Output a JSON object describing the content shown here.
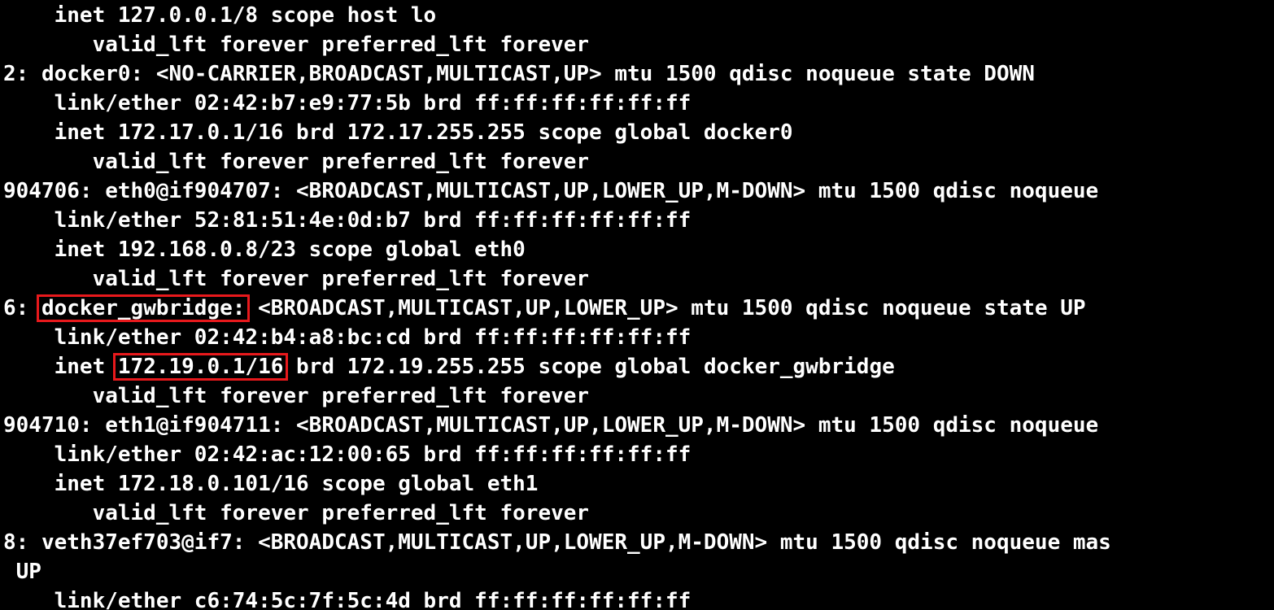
{
  "terminal": {
    "lines": [
      {
        "text": "    inet 127.0.0.1/8 scope host lo"
      },
      {
        "text": "       valid_lft forever preferred_lft forever"
      },
      {
        "text": "2: docker0: <NO-CARRIER,BROADCAST,MULTICAST,UP> mtu 1500 qdisc noqueue state DOWN"
      },
      {
        "text": "    link/ether 02:42:b7:e9:77:5b brd ff:ff:ff:ff:ff:ff"
      },
      {
        "text": "    inet 172.17.0.1/16 brd 172.17.255.255 scope global docker0"
      },
      {
        "text": "       valid_lft forever preferred_lft forever"
      },
      {
        "text": "904706: eth0@if904707: <BROADCAST,MULTICAST,UP,LOWER_UP,M-DOWN> mtu 1500 qdisc noqueue"
      },
      {
        "text": "    link/ether 52:81:51:4e:0d:b7 brd ff:ff:ff:ff:ff:ff"
      },
      {
        "text": "    inet 192.168.0.8/23 scope global eth0"
      },
      {
        "text": "       valid_lft forever preferred_lft forever"
      },
      {
        "prefix": "6: ",
        "highlight": "docker_gwbridge:",
        "suffix": " <BROADCAST,MULTICAST,UP,LOWER_UP> mtu 1500 qdisc noqueue state UP"
      },
      {
        "text": "    link/ether 02:42:b4:a8:bc:cd brd ff:ff:ff:ff:ff:ff"
      },
      {
        "prefix": "    inet ",
        "highlight": "172.19.0.1/16",
        "suffix": " brd 172.19.255.255 scope global docker_gwbridge"
      },
      {
        "text": "       valid_lft forever preferred_lft forever"
      },
      {
        "text": "904710: eth1@if904711: <BROADCAST,MULTICAST,UP,LOWER_UP,M-DOWN> mtu 1500 qdisc noqueue"
      },
      {
        "text": "    link/ether 02:42:ac:12:00:65 brd ff:ff:ff:ff:ff:ff"
      },
      {
        "text": "    inet 172.18.0.101/16 scope global eth1"
      },
      {
        "text": "       valid_lft forever preferred_lft forever"
      },
      {
        "text": "8: veth37ef703@if7: <BROADCAST,MULTICAST,UP,LOWER_UP,M-DOWN> mtu 1500 qdisc noqueue mas"
      },
      {
        "text": " UP"
      },
      {
        "text": "    link/ether c6:74:5c:7f:5c:4d brd ff:ff:ff:ff:ff:ff"
      }
    ]
  },
  "colors": {
    "background": "#000000",
    "text": "#ffffff",
    "highlight_border": "#e8191c"
  }
}
